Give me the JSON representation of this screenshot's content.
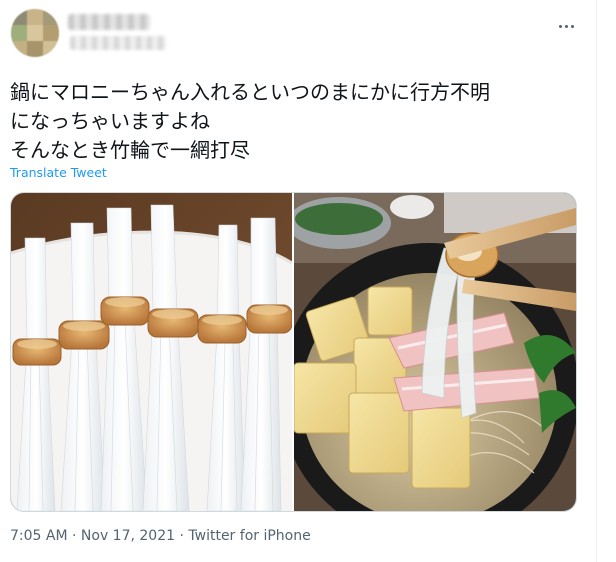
{
  "tweet": {
    "lines": [
      "鍋にマロニーちゃん入れるといつのまにかに行方不明",
      "になっちゃいますよね",
      "そんなとき竹輪で一網打尽"
    ],
    "translate_label": "Translate Tweet",
    "time": "7:05 AM",
    "separator_1": " · ",
    "date": "Nov 17, 2021",
    "separator_2": " · ",
    "source": "Twitter for iPhone"
  },
  "icons": {
    "more": "more-horizontal-icon"
  },
  "colors": {
    "link": "#1d9bf0",
    "text": "#0f1419",
    "secondary": "#536471",
    "border": "#cfd9de"
  }
}
